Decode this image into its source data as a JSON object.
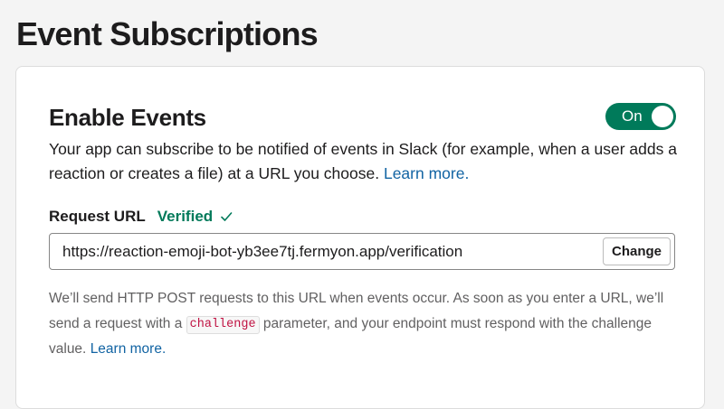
{
  "page": {
    "title": "Event Subscriptions"
  },
  "enable_events": {
    "title": "Enable Events",
    "toggle_label": "On",
    "toggle_on": true,
    "description": "Your app can subscribe to be notified of events in Slack (for example, when a user adds a reaction or creates a file) at a URL you choose.",
    "learn_more": "Learn more."
  },
  "request_url": {
    "label": "Request URL",
    "status": "Verified",
    "value": "https://reaction-emoji-bot-yb3ee7tj.fermyon.app/verification",
    "change_label": "Change"
  },
  "help": {
    "text_before": "We’ll send HTTP POST requests to this URL when events occur. As soon as you enter a URL, we’ll send a request with a",
    "code": "challenge",
    "text_after": "parameter, and your endpoint must respond with the challenge value.",
    "learn_more": "Learn more."
  },
  "colors": {
    "accent_green": "#007a5a",
    "link_blue": "#1264a3",
    "code_red": "#c01343"
  },
  "icons": {
    "verified": "check-icon"
  }
}
